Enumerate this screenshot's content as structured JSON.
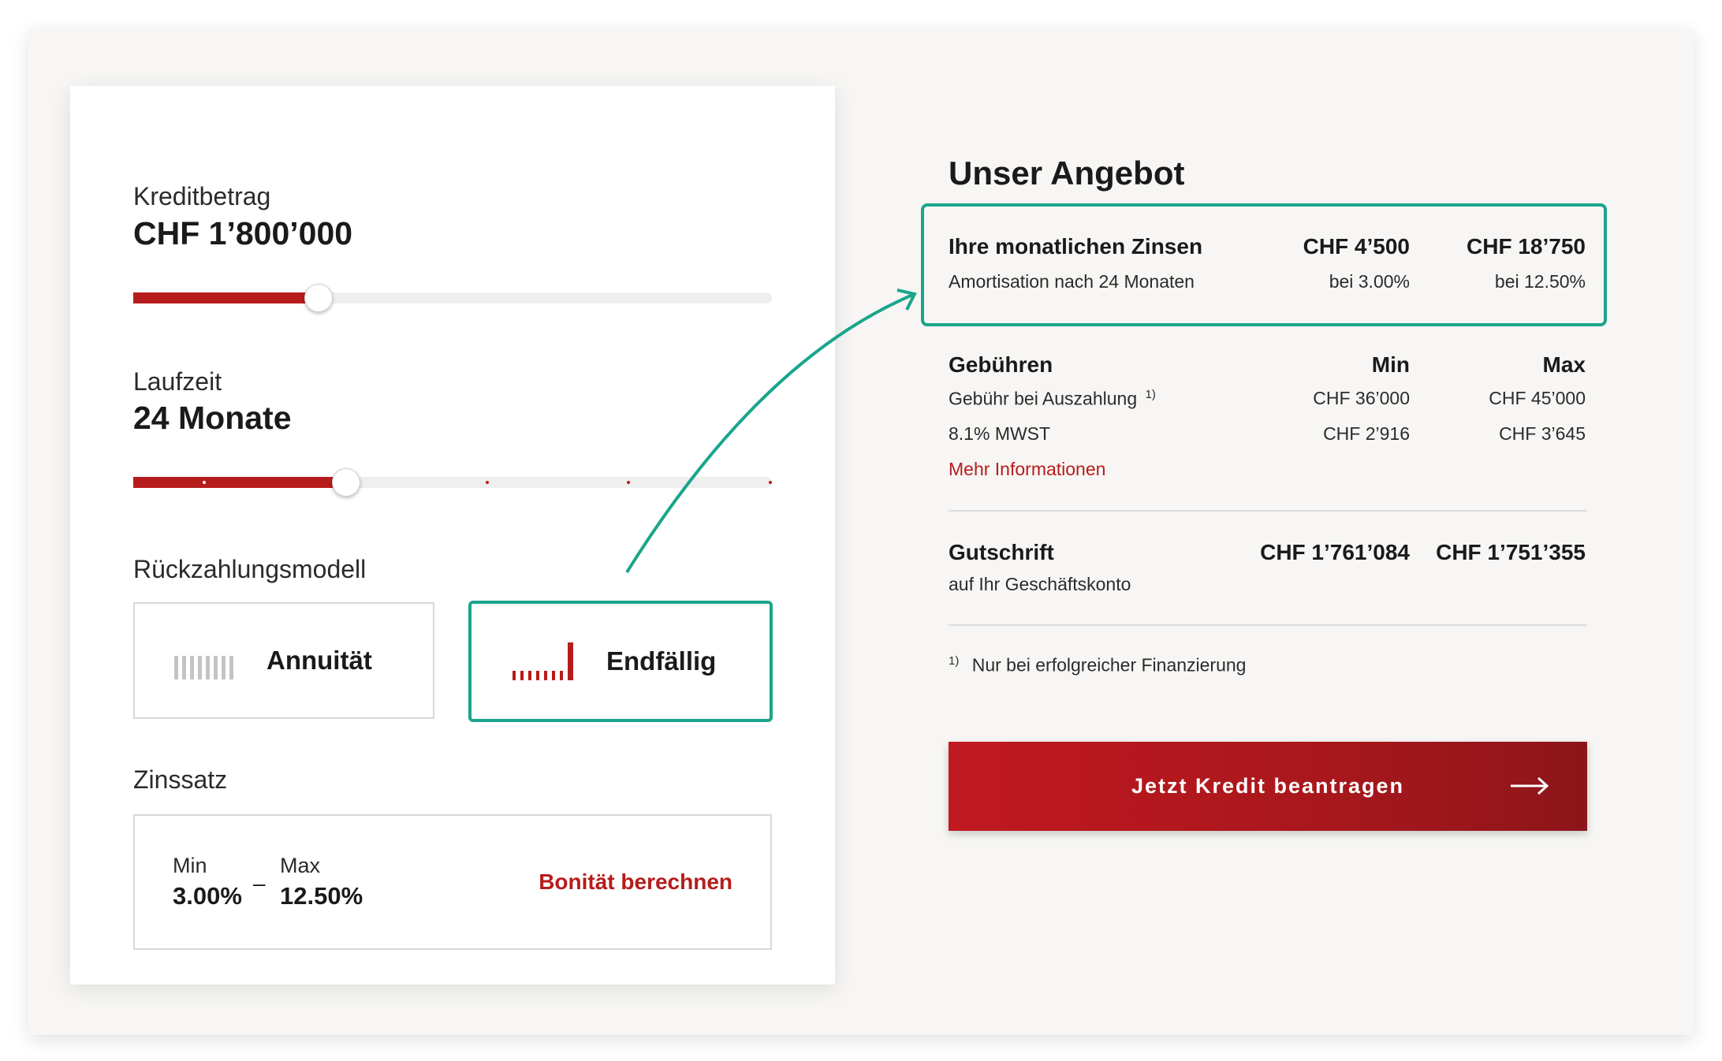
{
  "calculator": {
    "amount": {
      "label": "Kreditbetrag",
      "value": "CHF 1’800’000",
      "fill_percent": 29
    },
    "term": {
      "label": "Laufzeit",
      "value": "24 Monate",
      "fill_percent": 33
    },
    "repayment": {
      "label": "Rückzahlungsmodell",
      "options": [
        {
          "label": "Annuität",
          "selected": false
        },
        {
          "label": "Endfällig",
          "selected": true
        }
      ]
    },
    "rate": {
      "label": "Zinssatz",
      "min_label": "Min",
      "min_value": "3.00%",
      "separator": "–",
      "max_label": "Max",
      "max_value": "12.50%",
      "link": "Bonität berechnen"
    }
  },
  "offer": {
    "title": "Unser Angebot",
    "interest": {
      "title": "Ihre monatlichen Zinsen",
      "subtitle": "Amortisation nach 24 Monaten",
      "min_amount": "CHF 4’500",
      "min_rate": "bei 3.00%",
      "max_amount": "CHF 18’750",
      "max_rate": "bei 12.50%"
    },
    "fees": {
      "title": "Gebühren",
      "col_min": "Min",
      "col_max": "Max",
      "payout_label": "Gebühr bei Auszahlung",
      "payout_footnote": "1)",
      "payout_min": "CHF 36’000",
      "payout_max": "CHF 45’000",
      "vat_label": "8.1% MWST",
      "vat_min": "CHF 2’916",
      "vat_max": "CHF 3’645",
      "more_info": "Mehr Informationen"
    },
    "credit": {
      "title": "Gutschrift",
      "subtitle": "auf Ihr Geschäftskonto",
      "min": "CHF 1’761’084",
      "max": "CHF 1’751’355"
    },
    "footnote": {
      "marker": "1)",
      "text": "Nur bei erfolgreicher Finanzierung"
    },
    "cta": {
      "label": "Jetzt Kredit beantragen",
      "icon": "arrow-right-icon"
    }
  },
  "colors": {
    "accent": "#b71c1c",
    "highlight": "#1aa58c",
    "background": "#f7f6f4"
  }
}
